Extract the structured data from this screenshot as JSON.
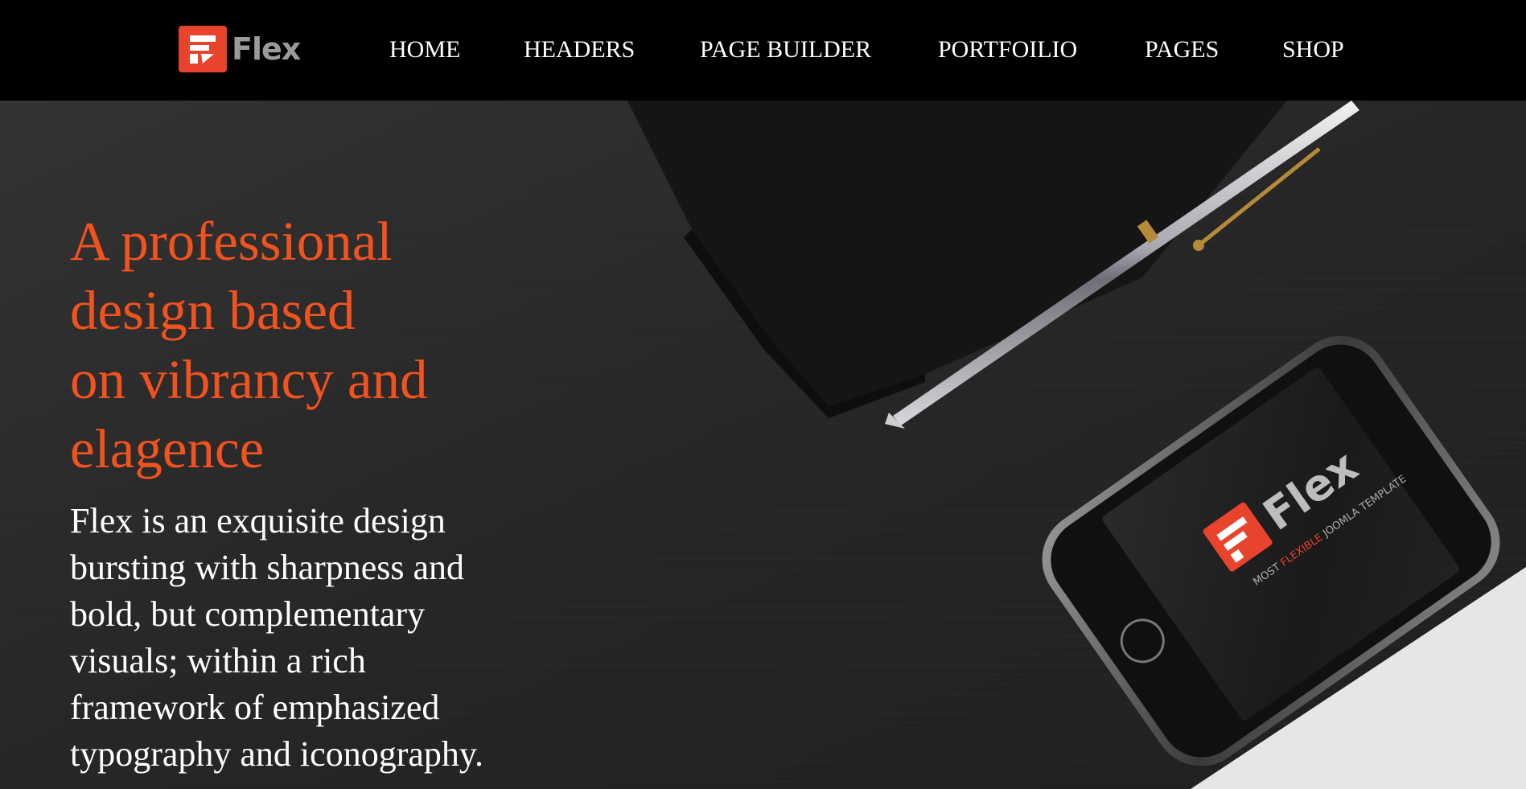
{
  "header": {
    "logo_text": "Flex",
    "nav": [
      {
        "label": "HOME",
        "name": "nav-home"
      },
      {
        "label": "HEADERS",
        "name": "nav-headers"
      },
      {
        "label": "PAGE BUILDER",
        "name": "nav-page-builder"
      },
      {
        "label": "PORTFOILIO",
        "name": "nav-portfolio"
      },
      {
        "label": "PAGES",
        "name": "nav-pages"
      },
      {
        "label": "SHOP",
        "name": "nav-shop"
      }
    ]
  },
  "hero": {
    "headline_lines": [
      "A professional",
      "design based",
      "on vibrancy and",
      "elagence"
    ],
    "body_lines": [
      "Flex is an exquisite design",
      "bursting with sharpness and",
      "bold, but complementary",
      "visuals; within a rich",
      "framework of emphasized",
      "typography and iconography."
    ],
    "phone_logo_text": "Flex",
    "phone_tagline": "MOST FLEXIBLE JOOMLA TEMPLATE",
    "phone_tagline_parts": {
      "before": "MOST ",
      "accent": "FLEXIBLE",
      "after": " JOOMLA TEMPLATE"
    }
  },
  "colors": {
    "brand": "#e8432d",
    "headline": "#f2521e",
    "navbar": "#000000",
    "hero_background": "#282828",
    "body_text": "#ffffff"
  },
  "icons": {
    "logo": "flex-logo-icon",
    "phone_home_button": "phone-home-button-icon"
  }
}
